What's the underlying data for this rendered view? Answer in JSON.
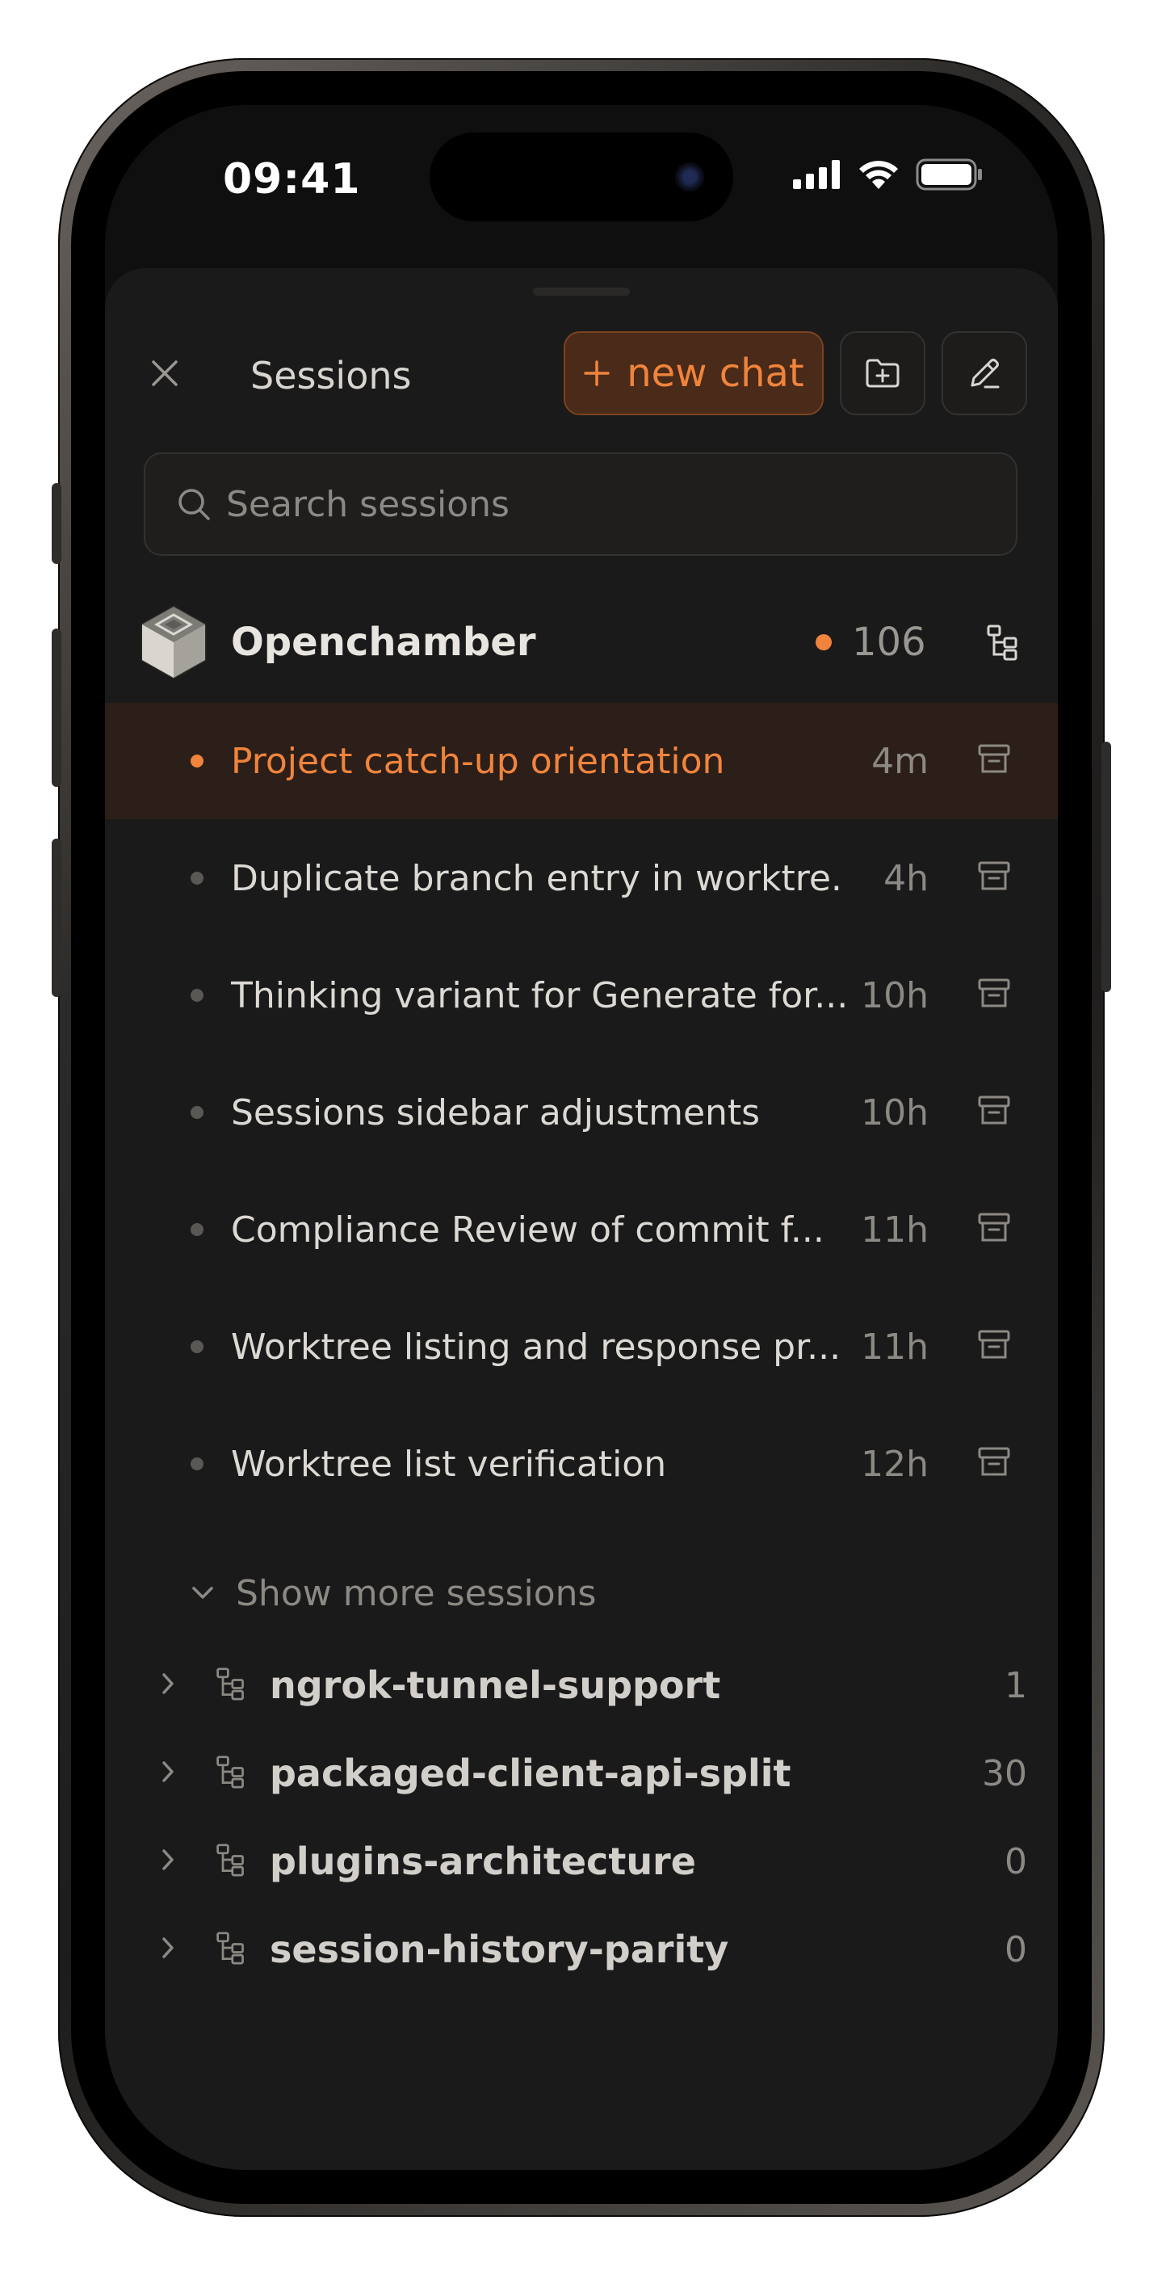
{
  "status_bar": {
    "time": "09:41"
  },
  "header": {
    "title": "Sessions",
    "new_chat_label": "new chat"
  },
  "search": {
    "placeholder": "Search sessions"
  },
  "project": {
    "name": "Openchamber",
    "count": "106"
  },
  "sessions": [
    {
      "title": "Project catch-up orientation",
      "time": "4m",
      "active": true
    },
    {
      "title": "Duplicate branch entry in worktre...",
      "time": "4h"
    },
    {
      "title": "Thinking variant for Generate for...",
      "time": "10h"
    },
    {
      "title": "Sessions sidebar adjustments",
      "time": "10h"
    },
    {
      "title": "Compliance Review of commit f...",
      "time": "11h"
    },
    {
      "title": "Worktree listing and response pr...",
      "time": "11h"
    },
    {
      "title": "Worktree list verification",
      "time": "12h"
    }
  ],
  "show_more_label": "Show more sessions",
  "branches": [
    {
      "name": "ngrok-tunnel-support",
      "count": "1"
    },
    {
      "name": "packaged-client-api-split",
      "count": "30"
    },
    {
      "name": "plugins-architecture",
      "count": "0"
    },
    {
      "name": "session-history-parity",
      "count": "0"
    }
  ],
  "colors": {
    "accent": "#f0843c",
    "background": "#1b1a1a",
    "active_row": "#2c1e18"
  }
}
